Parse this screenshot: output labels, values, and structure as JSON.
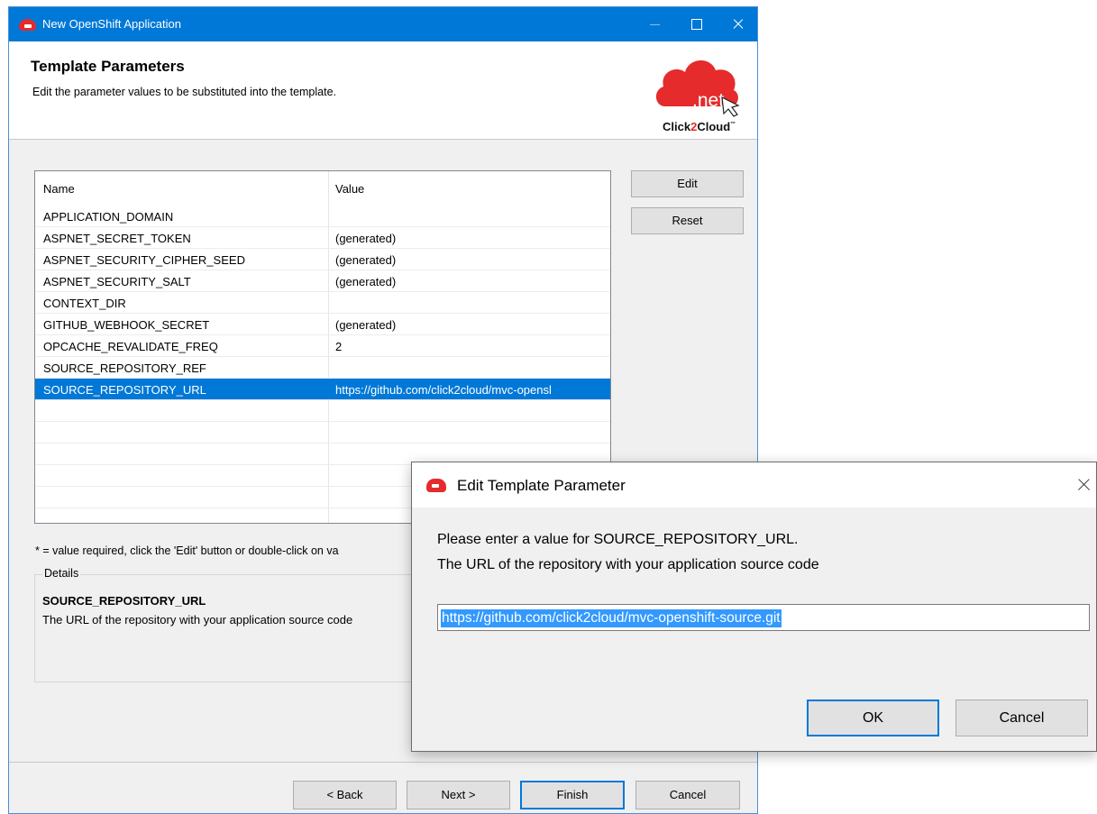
{
  "window": {
    "title": "New OpenShift Application",
    "header_title": "Template Parameters",
    "header_desc": "Edit the parameter values to be substituted into the template."
  },
  "logo": {
    "text_net": ".net",
    "text_brand_1": "Click",
    "text_brand_2": "2",
    "text_brand_3": "Cloud",
    "text_tm": "™"
  },
  "table": {
    "headers": {
      "name": "Name",
      "value": "Value"
    },
    "rows": [
      {
        "name": "APPLICATION_DOMAIN",
        "value": ""
      },
      {
        "name": "ASPNET_SECRET_TOKEN",
        "value": "(generated)"
      },
      {
        "name": "ASPNET_SECURITY_CIPHER_SEED",
        "value": "(generated)"
      },
      {
        "name": "ASPNET_SECURITY_SALT",
        "value": "(generated)"
      },
      {
        "name": "CONTEXT_DIR",
        "value": ""
      },
      {
        "name": "GITHUB_WEBHOOK_SECRET",
        "value": "(generated)"
      },
      {
        "name": "OPCACHE_REVALIDATE_FREQ",
        "value": "2"
      },
      {
        "name": "SOURCE_REPOSITORY_REF",
        "value": ""
      },
      {
        "name": "SOURCE_REPOSITORY_URL",
        "value": "https://github.com/click2cloud/mvc-opensl"
      }
    ],
    "selected_index": 8
  },
  "side_buttons": {
    "edit": "Edit",
    "reset": "Reset"
  },
  "note": "* = value required, click the 'Edit' button or double-click on va",
  "details": {
    "legend": "Details",
    "name": "SOURCE_REPOSITORY_URL",
    "desc": "The URL of the repository with your application source code"
  },
  "footer": {
    "back": "< Back",
    "next": "Next >",
    "finish": "Finish",
    "cancel": "Cancel"
  },
  "dialog": {
    "title": "Edit Template Parameter",
    "message1": "Please enter a value for SOURCE_REPOSITORY_URL.",
    "message2": "The URL of the repository with your application source code",
    "input_value": "https://github.com/click2cloud/mvc-openshift-source.git",
    "ok": "OK",
    "cancel": "Cancel"
  },
  "colors": {
    "titlebar": "#0078d7",
    "selection": "#0078d7",
    "logo_red": "#e52b2b"
  }
}
